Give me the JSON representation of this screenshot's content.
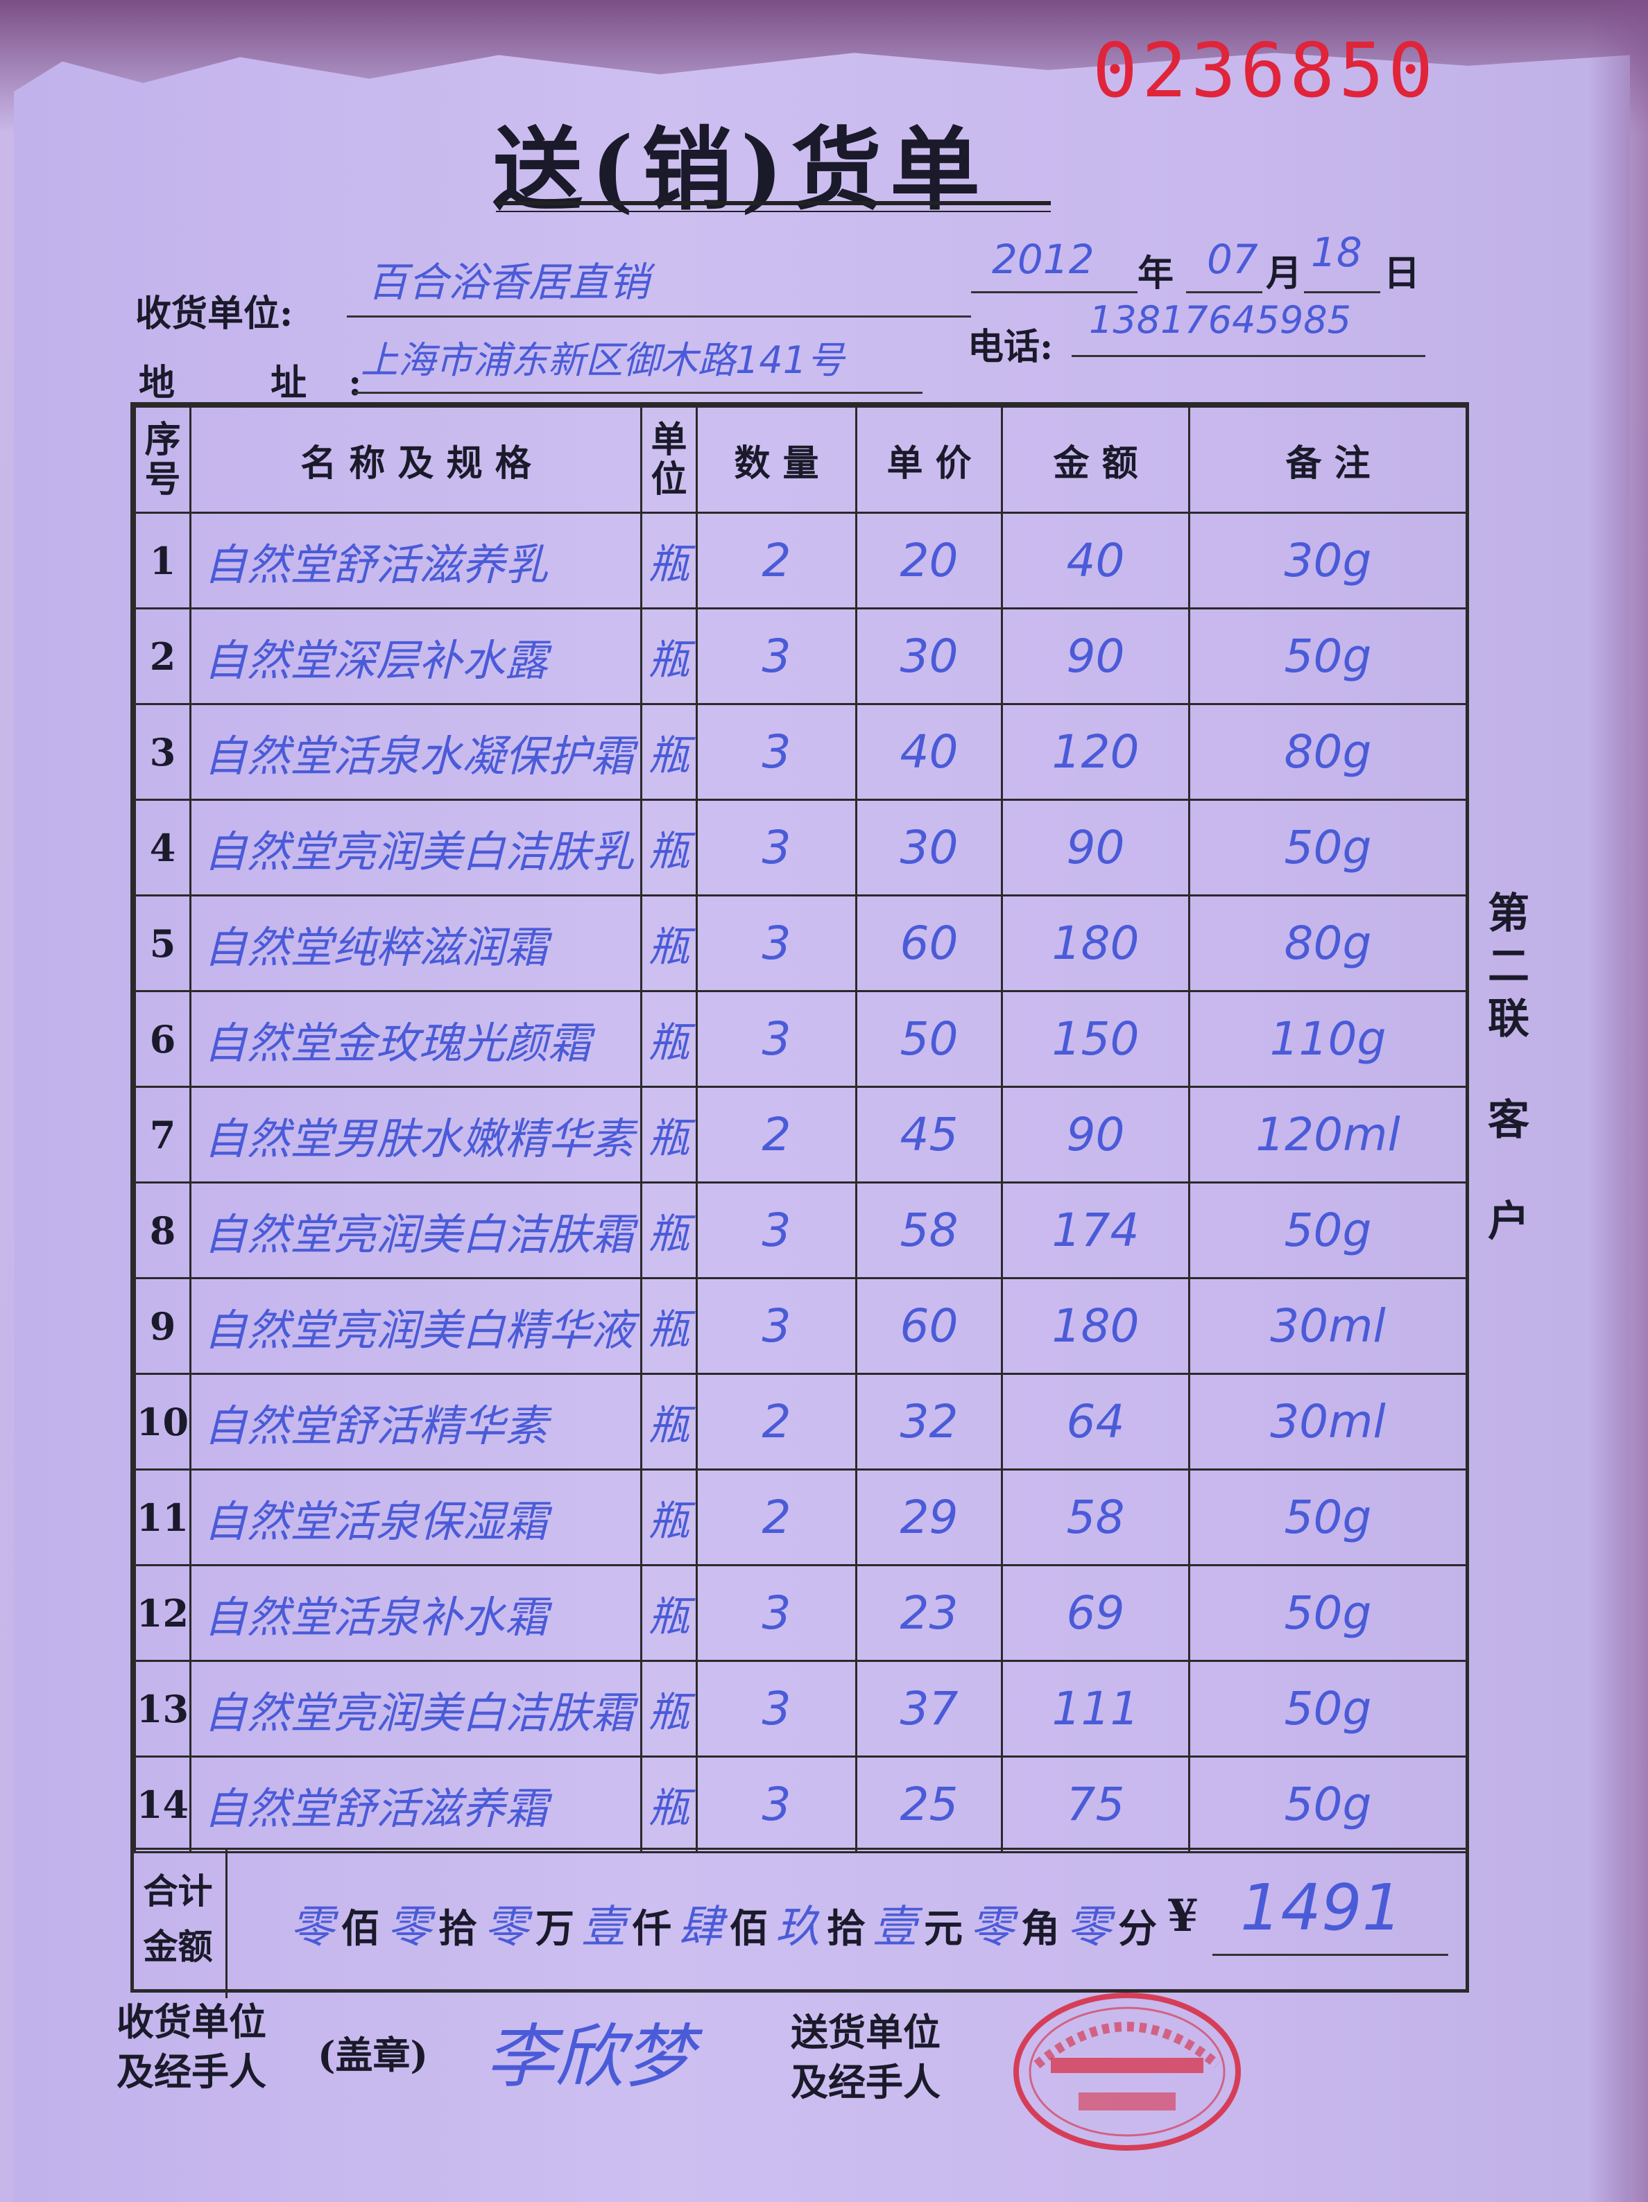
{
  "form": {
    "serial_number": "0236850",
    "title": "送(销)货单",
    "copy_label_top": [
      "第",
      "二",
      "联"
    ],
    "copy_label_bottom": [
      "客",
      "户"
    ]
  },
  "header": {
    "receiver_label": "收货单位:",
    "receiver_value": "百合浴香居直销",
    "address_label": "地 址:",
    "address_value": "上海市浦东新区御木路141号",
    "phone_label": "电话:",
    "phone_value": "13817645985",
    "year_value": "2012",
    "year_label": "年",
    "month_value": "07",
    "month_label": "月",
    "day_value": "18",
    "day_label": "日"
  },
  "table": {
    "headers": {
      "seq": "序号",
      "name": "名 称 及 规 格",
      "unit": "单位",
      "qty": "数 量",
      "price": "单 价",
      "amount": "金 额",
      "note": "备 注"
    },
    "rows": [
      {
        "seq": "1",
        "name": "自然堂舒活滋养乳",
        "unit": "瓶",
        "qty": "2",
        "price": "20",
        "amount": "40",
        "note": "30g"
      },
      {
        "seq": "2",
        "name": "自然堂深层补水露",
        "unit": "瓶",
        "qty": "3",
        "price": "30",
        "amount": "90",
        "note": "50g"
      },
      {
        "seq": "3",
        "name": "自然堂活泉水凝保护霜",
        "unit": "瓶",
        "qty": "3",
        "price": "40",
        "amount": "120",
        "note": "80g"
      },
      {
        "seq": "4",
        "name": "自然堂亮润美白洁肤乳",
        "unit": "瓶",
        "qty": "3",
        "price": "30",
        "amount": "90",
        "note": "50g"
      },
      {
        "seq": "5",
        "name": "自然堂纯粹滋润霜",
        "unit": "瓶",
        "qty": "3",
        "price": "60",
        "amount": "180",
        "note": "80g"
      },
      {
        "seq": "6",
        "name": "自然堂金玫瑰光颜霜",
        "unit": "瓶",
        "qty": "3",
        "price": "50",
        "amount": "150",
        "note": "110g"
      },
      {
        "seq": "7",
        "name": "自然堂男肤水嫩精华素",
        "unit": "瓶",
        "qty": "2",
        "price": "45",
        "amount": "90",
        "note": "120ml"
      },
      {
        "seq": "8",
        "name": "自然堂亮润美白洁肤霜",
        "unit": "瓶",
        "qty": "3",
        "price": "58",
        "amount": "174",
        "note": "50g"
      },
      {
        "seq": "9",
        "name": "自然堂亮润美白精华液",
        "unit": "瓶",
        "qty": "3",
        "price": "60",
        "amount": "180",
        "note": "30ml"
      },
      {
        "seq": "10",
        "name": "自然堂舒活精华素",
        "unit": "瓶",
        "qty": "2",
        "price": "32",
        "amount": "64",
        "note": "30ml"
      },
      {
        "seq": "11",
        "name": "自然堂活泉保湿霜",
        "unit": "瓶",
        "qty": "2",
        "price": "29",
        "amount": "58",
        "note": "50g"
      },
      {
        "seq": "12",
        "name": "自然堂活泉补水霜",
        "unit": "瓶",
        "qty": "3",
        "price": "23",
        "amount": "69",
        "note": "50g"
      },
      {
        "seq": "13",
        "name": "自然堂亮润美白洁肤霜",
        "unit": "瓶",
        "qty": "3",
        "price": "37",
        "amount": "111",
        "note": "50g"
      },
      {
        "seq": "14",
        "name": "自然堂舒活滋养霜",
        "unit": "瓶",
        "qty": "3",
        "price": "25",
        "amount": "75",
        "note": "50g"
      }
    ]
  },
  "total": {
    "label_line1": "合计",
    "label_line2": "金额",
    "capital": [
      {
        "digit": "零",
        "unit": "佰"
      },
      {
        "digit": "零",
        "unit": "拾"
      },
      {
        "digit": "零",
        "unit": "万"
      },
      {
        "digit": "壹",
        "unit": "仟"
      },
      {
        "digit": "肆",
        "unit": "佰"
      },
      {
        "digit": "玖",
        "unit": "拾"
      },
      {
        "digit": "壹",
        "unit": "元"
      },
      {
        "digit": "零",
        "unit": "角"
      },
      {
        "digit": "零",
        "unit": "分"
      }
    ],
    "currency_symbol": "¥",
    "amount": "1491"
  },
  "footer": {
    "receiver_sign_line1": "收货单位",
    "receiver_sign_line2": "及经手人",
    "stamp_note": "(盖章)",
    "receiver_signature": "李欣梦",
    "sender_sign_line1": "送货单位",
    "sender_sign_line2": "及经手人"
  },
  "colors": {
    "paper": "#c8b8ee",
    "ink_blue": "#4a5bd8",
    "serial_red": "#e0243a",
    "seal_red": "#d8283c",
    "print_black": "#1a1a2a"
  }
}
